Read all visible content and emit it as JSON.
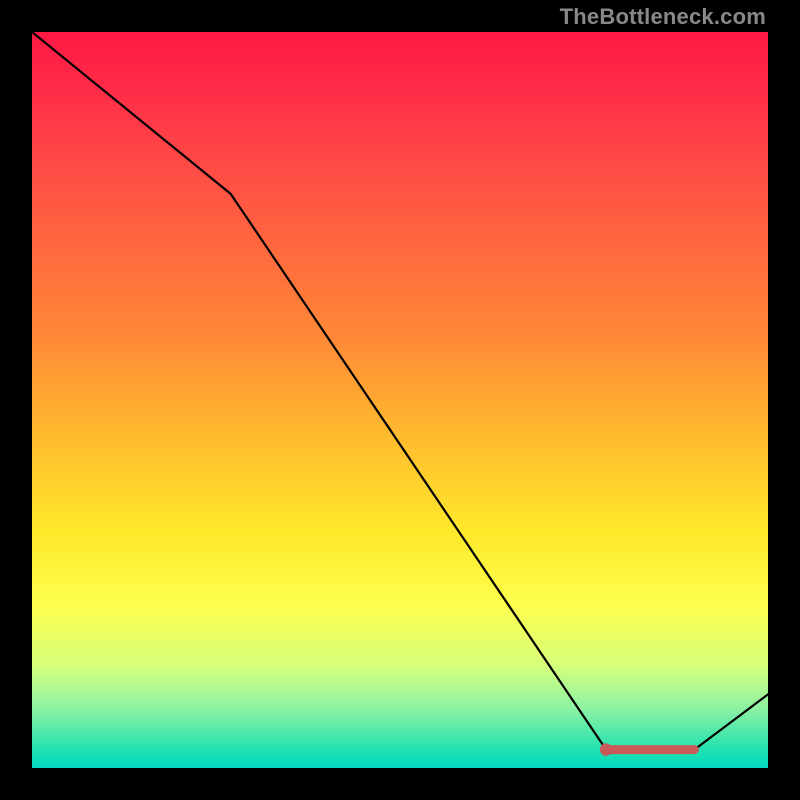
{
  "credit": "TheBottleneck.com",
  "colors": {
    "background": "#000000",
    "line": "#000000",
    "marker": "#c85a5a",
    "gradient_top": "#ff1844",
    "gradient_bottom": "#05d9c1"
  },
  "chart_data": {
    "type": "line",
    "title": "",
    "xlabel": "",
    "ylabel": "",
    "xlim": [
      0,
      100
    ],
    "ylim": [
      0,
      100
    ],
    "x": [
      0,
      27,
      78,
      90,
      100
    ],
    "values": [
      100,
      78,
      2.5,
      2.5,
      10
    ],
    "highlighted_segment": {
      "x": [
        78,
        90
      ],
      "values": [
        2.5,
        2.5
      ]
    }
  }
}
